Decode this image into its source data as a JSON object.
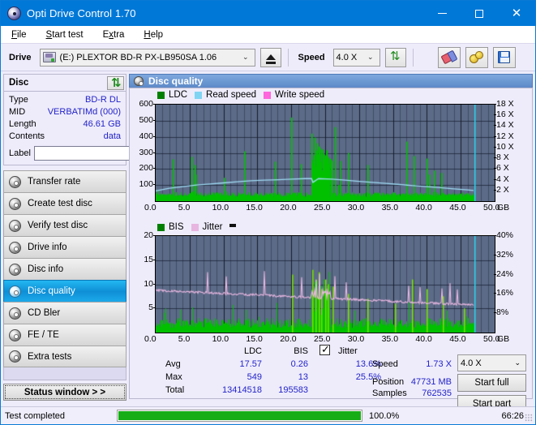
{
  "window": {
    "title": "Opti Drive Control 1.70",
    "title_icon": "disc-icon",
    "minimize": "—",
    "maximize": "□",
    "close": "✕"
  },
  "menu": [
    {
      "label": "File",
      "accel": "F"
    },
    {
      "label": "Start test",
      "accel": "S"
    },
    {
      "label": "Extra",
      "accel": "x"
    },
    {
      "label": "Help",
      "accel": "H"
    }
  ],
  "toolbar": {
    "drive_label": "Drive",
    "drive_value": "(E:)  PLEXTOR BD-R  PX-LB950SA 1.06",
    "eject_title": "eject",
    "refresh_title": "refresh",
    "speed_label": "Speed",
    "speed_value": "4.0 X",
    "erase_title": "erase",
    "settings_title": "settings",
    "save_title": "save"
  },
  "disc": {
    "header": "Disc",
    "refresh_icon": "refresh-icon",
    "rows": [
      {
        "key": "Type",
        "value": "BD-R DL"
      },
      {
        "key": "MID",
        "value": "VERBATIMd (000)"
      },
      {
        "key": "Length",
        "value": "46.61 GB"
      },
      {
        "key": "Contents",
        "value": "data"
      }
    ],
    "label_key": "Label",
    "label_value": "",
    "label_placeholder": ""
  },
  "nav": {
    "items": [
      {
        "label": "Transfer rate",
        "active": false
      },
      {
        "label": "Create test disc",
        "active": false
      },
      {
        "label": "Verify test disc",
        "active": false
      },
      {
        "label": "Drive info",
        "active": false
      },
      {
        "label": "Disc info",
        "active": false
      },
      {
        "label": "Disc quality",
        "active": true
      },
      {
        "label": "CD Bler",
        "active": false
      },
      {
        "label": "FE / TE",
        "active": false
      },
      {
        "label": "Extra tests",
        "active": false
      }
    ],
    "status_window": "Status window > >"
  },
  "main": {
    "header": "Disc quality"
  },
  "chart_data": [
    {
      "id": "top-chart",
      "type": "line",
      "title": "",
      "xlabel": "GB",
      "ylabel": "",
      "y2label": "X",
      "xlim": [
        0.0,
        50.0
      ],
      "ylim": [
        0,
        600
      ],
      "y2lim": [
        0,
        18
      ],
      "xticks": [
        "0.0",
        "5.0",
        "10.0",
        "15.0",
        "20.0",
        "25.0",
        "30.0",
        "35.0",
        "40.0",
        "45.0",
        "50.0"
      ],
      "x_unit": "GB",
      "yticks": [
        "100",
        "200",
        "300",
        "400",
        "500",
        "600"
      ],
      "y2ticks": [
        "2 X",
        "4 X",
        "6 X",
        "8 X",
        "10 X",
        "12 X",
        "14 X",
        "16 X",
        "18 X"
      ],
      "grid": true,
      "legend": [
        {
          "label": "LDC",
          "color": "#008000"
        },
        {
          "label": "Read speed",
          "color": "#7fd4f2"
        },
        {
          "label": "Write speed",
          "color": "#ff66dd"
        }
      ],
      "series": [
        {
          "name": "LDC",
          "color": "#00c000",
          "render": "bars",
          "x": [
            0.2,
            0.5,
            0.9,
            1.3,
            1.7,
            2.1,
            2.5,
            2.6,
            2.9,
            3.3,
            3.7,
            4.1,
            4.5,
            4.9,
            5.3,
            5.5,
            5.7,
            5.9,
            6.1,
            6.5,
            6.9,
            7.3,
            7.7,
            8.1,
            8.5,
            8.9,
            9.3,
            9.7,
            10.1,
            10.3,
            10.6,
            11.0,
            11.4,
            11.8,
            12.2,
            12.6,
            13.0,
            13.4,
            13.6,
            14.0,
            14.4,
            14.8,
            15.2,
            15.6,
            16.0,
            16.4,
            16.8,
            17.2,
            17.6,
            18.0,
            18.2,
            18.6,
            19.0,
            19.4,
            19.8,
            20.0,
            20.2,
            20.6,
            21.0,
            21.4,
            21.8,
            22.2,
            22.6,
            23.0,
            23.2,
            23.4,
            23.6,
            23.8,
            24.0,
            24.2,
            24.4,
            24.6,
            24.8,
            25.0,
            25.2,
            25.4,
            25.6,
            25.8,
            26.0,
            26.4,
            26.8,
            26.9,
            27.2,
            27.6,
            28.0,
            28.4,
            28.8,
            29.2,
            29.6,
            30.0,
            30.4,
            30.8,
            31.2,
            31.4,
            31.8,
            32.2,
            32.6,
            33.0,
            33.4,
            33.8,
            34.2,
            34.6,
            35.0,
            35.4,
            35.8,
            36.2,
            36.6,
            37.0,
            37.4,
            37.8,
            38.0,
            38.4,
            38.8,
            39.2,
            39.6,
            40.0,
            40.3,
            40.7,
            41.0,
            41.3,
            41.7,
            42.1,
            42.5,
            42.9,
            43.3,
            43.7,
            44.1,
            44.5,
            44.9,
            45.3,
            45.7,
            46.1,
            46.5,
            46.9
          ],
          "values": [
            70,
            35,
            30,
            40,
            28,
            35,
            260,
            30,
            30,
            35,
            30,
            38,
            30,
            35,
            275,
            60,
            225,
            165,
            38,
            35,
            30,
            40,
            35,
            30,
            35,
            30,
            40,
            35,
            145,
            60,
            30,
            35,
            38,
            30,
            40,
            30,
            310,
            40,
            38,
            35,
            30,
            40,
            30,
            35,
            38,
            30,
            40,
            35,
            245,
            40,
            30,
            38,
            35,
            40,
            30,
            520,
            35,
            38,
            30,
            230,
            30,
            35,
            40,
            420,
            30,
            395,
            90,
            360,
            340,
            330,
            320,
            300,
            290,
            285,
            280,
            275,
            265,
            260,
            250,
            460,
            40,
            100,
            250,
            45,
            50,
            300,
            40,
            35,
            45,
            50,
            40,
            45,
            225,
            45,
            40,
            35,
            45,
            40,
            50,
            45,
            40,
            45,
            50,
            40,
            45,
            40,
            45,
            370,
            40,
            45,
            280,
            45,
            40,
            45,
            50,
            265,
            165,
            40,
            190,
            45,
            40,
            175,
            45,
            40,
            45,
            40,
            45,
            40,
            45,
            40,
            45,
            40,
            20,
            0
          ]
        },
        {
          "name": "Read speed",
          "color": "#9fdcf5",
          "render": "line",
          "x": [
            0.0,
            2.0,
            4.0,
            6.0,
            8.0,
            10.0,
            12.0,
            14.0,
            16.0,
            18.0,
            20.0,
            22.0,
            23.0,
            23.2,
            24.0,
            26.0,
            28.0,
            30.0,
            32.0,
            34.0,
            36.0,
            38.0,
            40.0,
            42.0,
            44.0,
            46.0,
            46.9
          ],
          "values": [
            1.9,
            2.4,
            2.7,
            3.0,
            3.2,
            3.4,
            3.6,
            3.8,
            3.9,
            4.0,
            4.1,
            4.2,
            4.2,
            3.5,
            4.2,
            4.1,
            3.9,
            3.7,
            3.5,
            3.3,
            3.1,
            2.9,
            2.7,
            2.5,
            2.3,
            2.1,
            2.0
          ],
          "unit": "X"
        },
        {
          "name": "Write speed",
          "color": "#ff66dd",
          "render": "line",
          "x": [],
          "values": []
        }
      ],
      "markers": [
        {
          "type": "vline",
          "x": 47.0,
          "color": "#28d6f0"
        }
      ]
    },
    {
      "id": "bottom-chart",
      "type": "line",
      "title": "",
      "xlabel": "GB",
      "xlim": [
        0.0,
        50.0
      ],
      "ylim": [
        0,
        20
      ],
      "y2lim": [
        0,
        40
      ],
      "xticks": [
        "0.0",
        "5.0",
        "10.0",
        "15.0",
        "20.0",
        "25.0",
        "30.0",
        "35.0",
        "40.0",
        "45.0",
        "50.0"
      ],
      "x_unit": "GB",
      "yticks": [
        "5",
        "10",
        "15",
        "20"
      ],
      "y2ticks": [
        "8%",
        "16%",
        "24%",
        "32%",
        "40%"
      ],
      "grid": true,
      "legend": [
        {
          "label": "BIS",
          "color": "#008000"
        },
        {
          "label": "Jitter",
          "color": "#e8b5e0"
        }
      ],
      "series": [
        {
          "name": "BIS",
          "color": "#00c000",
          "render": "bars",
          "avg": 0.26,
          "max": 13
        },
        {
          "name": "Jitter",
          "color": "#eab8e2",
          "render": "line",
          "avg_pct": "13.6%",
          "max_pct": "25.5%"
        }
      ],
      "markers": [
        {
          "type": "vline",
          "x": 47.0,
          "color": "#28d6f0"
        }
      ]
    }
  ],
  "stats": {
    "col_headers": [
      "LDC",
      "BIS"
    ],
    "jitter_label": "Jitter",
    "jitter_checked": true,
    "rows": [
      {
        "key": "Avg",
        "ldc": "17.57",
        "bis": "0.26",
        "jitter": "13.6%"
      },
      {
        "key": "Max",
        "ldc": "549",
        "bis": "13",
        "jitter": "25.5%"
      },
      {
        "key": "Total",
        "ldc": "13414518",
        "bis": "195583",
        "jitter": ""
      }
    ],
    "speed_key": "Speed",
    "speed_value": "1.73 X",
    "position_key": "Position",
    "position_value": "47731 MB",
    "samples_key": "Samples",
    "samples_value": "762535",
    "speed_select": "4.0 X",
    "start_full": "Start full",
    "start_part": "Start part"
  },
  "statusbar": {
    "message": "Test completed",
    "percent_label": "100.0%",
    "percent_value": 100,
    "elapsed": "66:26"
  }
}
